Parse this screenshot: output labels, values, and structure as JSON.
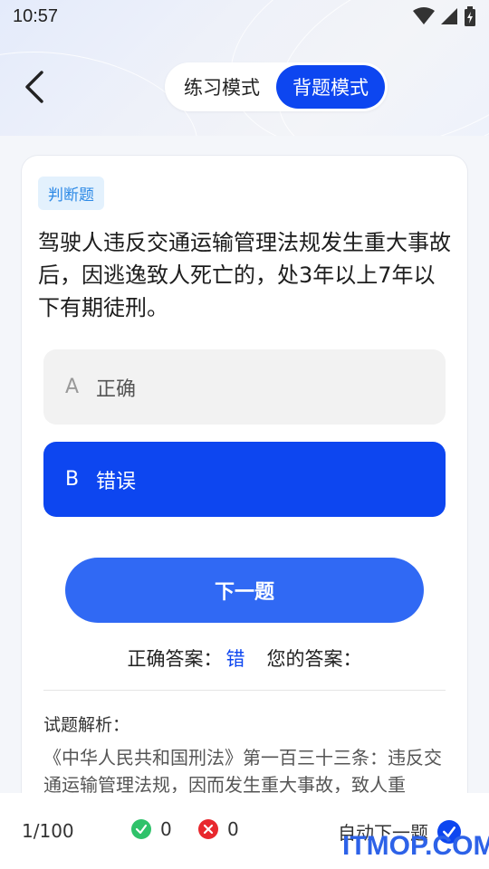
{
  "status_bar": {
    "time": "10:57"
  },
  "header": {
    "back_icon": "chevron-left-icon",
    "modes": [
      {
        "label": "练习模式",
        "active": false
      },
      {
        "label": "背题模式",
        "active": true
      }
    ]
  },
  "question": {
    "type_badge": "判断题",
    "text": "驾驶人违反交通运输管理法规发生重大事故后，因逃逸致人死亡的，处3年以上7年以下有期徒刑。",
    "options": [
      {
        "letter": "A",
        "text": "正确"
      },
      {
        "letter": "B",
        "text": "错误"
      }
    ]
  },
  "next_button": "下一题",
  "answer": {
    "correct_label": "正确答案：",
    "correct_value": "错",
    "yours_label": "您的答案："
  },
  "analysis": {
    "title": "试题解析：",
    "text": "《中华人民共和国刑法》第一百三十三条：违反交通运输管理法规，因而发生重大事故，致人重"
  },
  "bottom_bar": {
    "progress": "1/100",
    "correct_count": "0",
    "wrong_count": "0",
    "auto_next_label": "自动下一题"
  },
  "watermark": "ITMOP.COM",
  "colors": {
    "accent": "#0d46f0",
    "button": "#3069f4",
    "badge_bg": "#e3f1fd",
    "badge_text": "#2e8ae6",
    "correct": "#2fc26a",
    "wrong": "#e8282e"
  }
}
